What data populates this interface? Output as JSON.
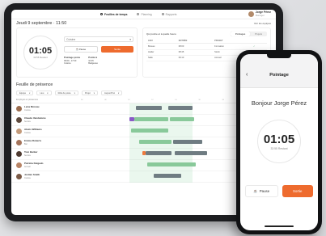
{
  "tablet": {
    "nav": {
      "tabs": [
        {
          "label": "Feuilles de temps"
        },
        {
          "label": "Planning"
        },
        {
          "label": "Rapports"
        }
      ],
      "user_name": "Jorge Pérez",
      "user_role": "Manager"
    },
    "date_title": "Jeudi 9 septembre · 11:50",
    "top_link": "Voir les équipes",
    "clock": {
      "time": "01:05",
      "subtitle": "32:55 Restant",
      "select_value": "Cuisine",
      "pause_label": "Pause",
      "stop_label": "Sortie",
      "info": [
        {
          "title": "Pointage prévu",
          "lines": [
            "09:00 - 17:00",
            "Cuisine"
          ]
        },
        {
          "title": "Pointé à",
          "lines": [
            "10:45",
            "Badgeuse"
          ]
        }
      ]
    },
    "table": {
      "title": "Qui pointe et à quelle heure",
      "seg": [
        "Pointages",
        "Projets"
      ],
      "columns": [
        "LIEU",
        "ENTRÉE",
        "PROJET"
      ],
      "rows": [
        {
          "who": "Bureau",
          "in": "08:00",
          "project": "Formation",
          "status": "ok"
        },
        {
          "who": "Atelier",
          "in": "08:45",
          "project": "Stock",
          "status": "ok"
        },
        {
          "who": "Salle",
          "in": "09:10",
          "project": "Accueil",
          "status": "no"
        }
      ]
    },
    "planning": {
      "title": "Feuille de présence",
      "filters": [
        "Équipe",
        "Lieu",
        "Rôle de poste",
        "Projet",
        "Aujourd'hui"
      ],
      "scale_label": "Employés et présences",
      "ticks": [
        "06",
        "08",
        "10",
        "12",
        "14",
        "16",
        "18",
        "20",
        "22"
      ],
      "people": [
        {
          "name": "Lena Moreau",
          "role": "Cuisine"
        },
        {
          "name": "Claude Vandamme",
          "role": "Service"
        },
        {
          "name": "Alexis Williams",
          "role": "Cuisine"
        },
        {
          "name": "Emma Roberts",
          "role": "Bar"
        },
        {
          "name": "Tom Barker",
          "role": "Service"
        },
        {
          "name": "Patricia Delgado",
          "role": "Accueil"
        },
        {
          "name": "Jordan Smith",
          "role": "Cuisine"
        }
      ]
    }
  },
  "phone": {
    "title": "Pointage",
    "greeting": "Bonjour Jorge Pérez",
    "time": "01:05",
    "subtitle": "32:55 Restant",
    "pause_label": "Pause",
    "stop_label": "Sortie"
  },
  "colors": {
    "accent": "#ee6b2e",
    "bar_gray": "#6f7c82",
    "bar_green": "#89c99a",
    "bar_purple": "#8a5ac7"
  }
}
